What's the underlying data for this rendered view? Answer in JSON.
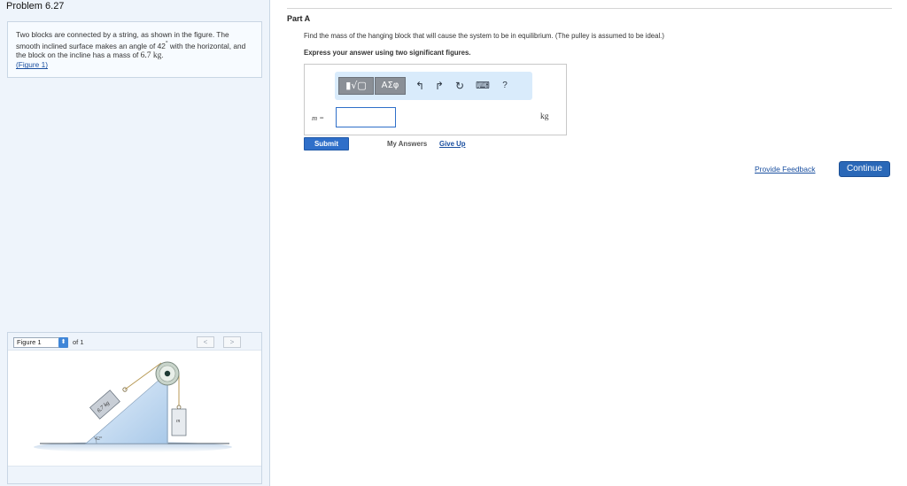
{
  "problem": {
    "title": "Problem 6.27",
    "text_part1": "Two blocks are connected by a string, as shown in the figure. The smooth inclined surface makes an angle of 42",
    "degree_symbol": "°",
    "text_part2": " with the horizontal, and the block on the incline has a mass of ",
    "mass_value": "6.7 kg",
    "text_part3": ".",
    "figure_link": "(Figure 1)"
  },
  "figure_panel": {
    "select_value": "Figure 1",
    "of_text": "of 1",
    "prev_label": "<",
    "next_label": ">",
    "block_label": "6.7 kg",
    "hanging_label": "m",
    "angle_label": "42°"
  },
  "part": {
    "title": "Part A",
    "question": "Find the mass of the hanging block that will cause the system to be in equilibrium. (The pulley is assumed to be ideal.)",
    "instruction": "Express your answer using two significant figures."
  },
  "answer": {
    "toolbar_templates": "▮√▢",
    "toolbar_greek": "ΑΣφ",
    "undo_icon": "↰",
    "redo_icon": "↱",
    "reset_icon": "↻",
    "keyboard_icon": "⌨",
    "help_icon": "?",
    "variable_label": "m =",
    "input_value": "",
    "unit": "kg"
  },
  "actions": {
    "submit": "Submit",
    "my_answers": "My Answers",
    "give_up": "Give Up",
    "provide_feedback": "Provide Feedback",
    "continue": "Continue"
  }
}
